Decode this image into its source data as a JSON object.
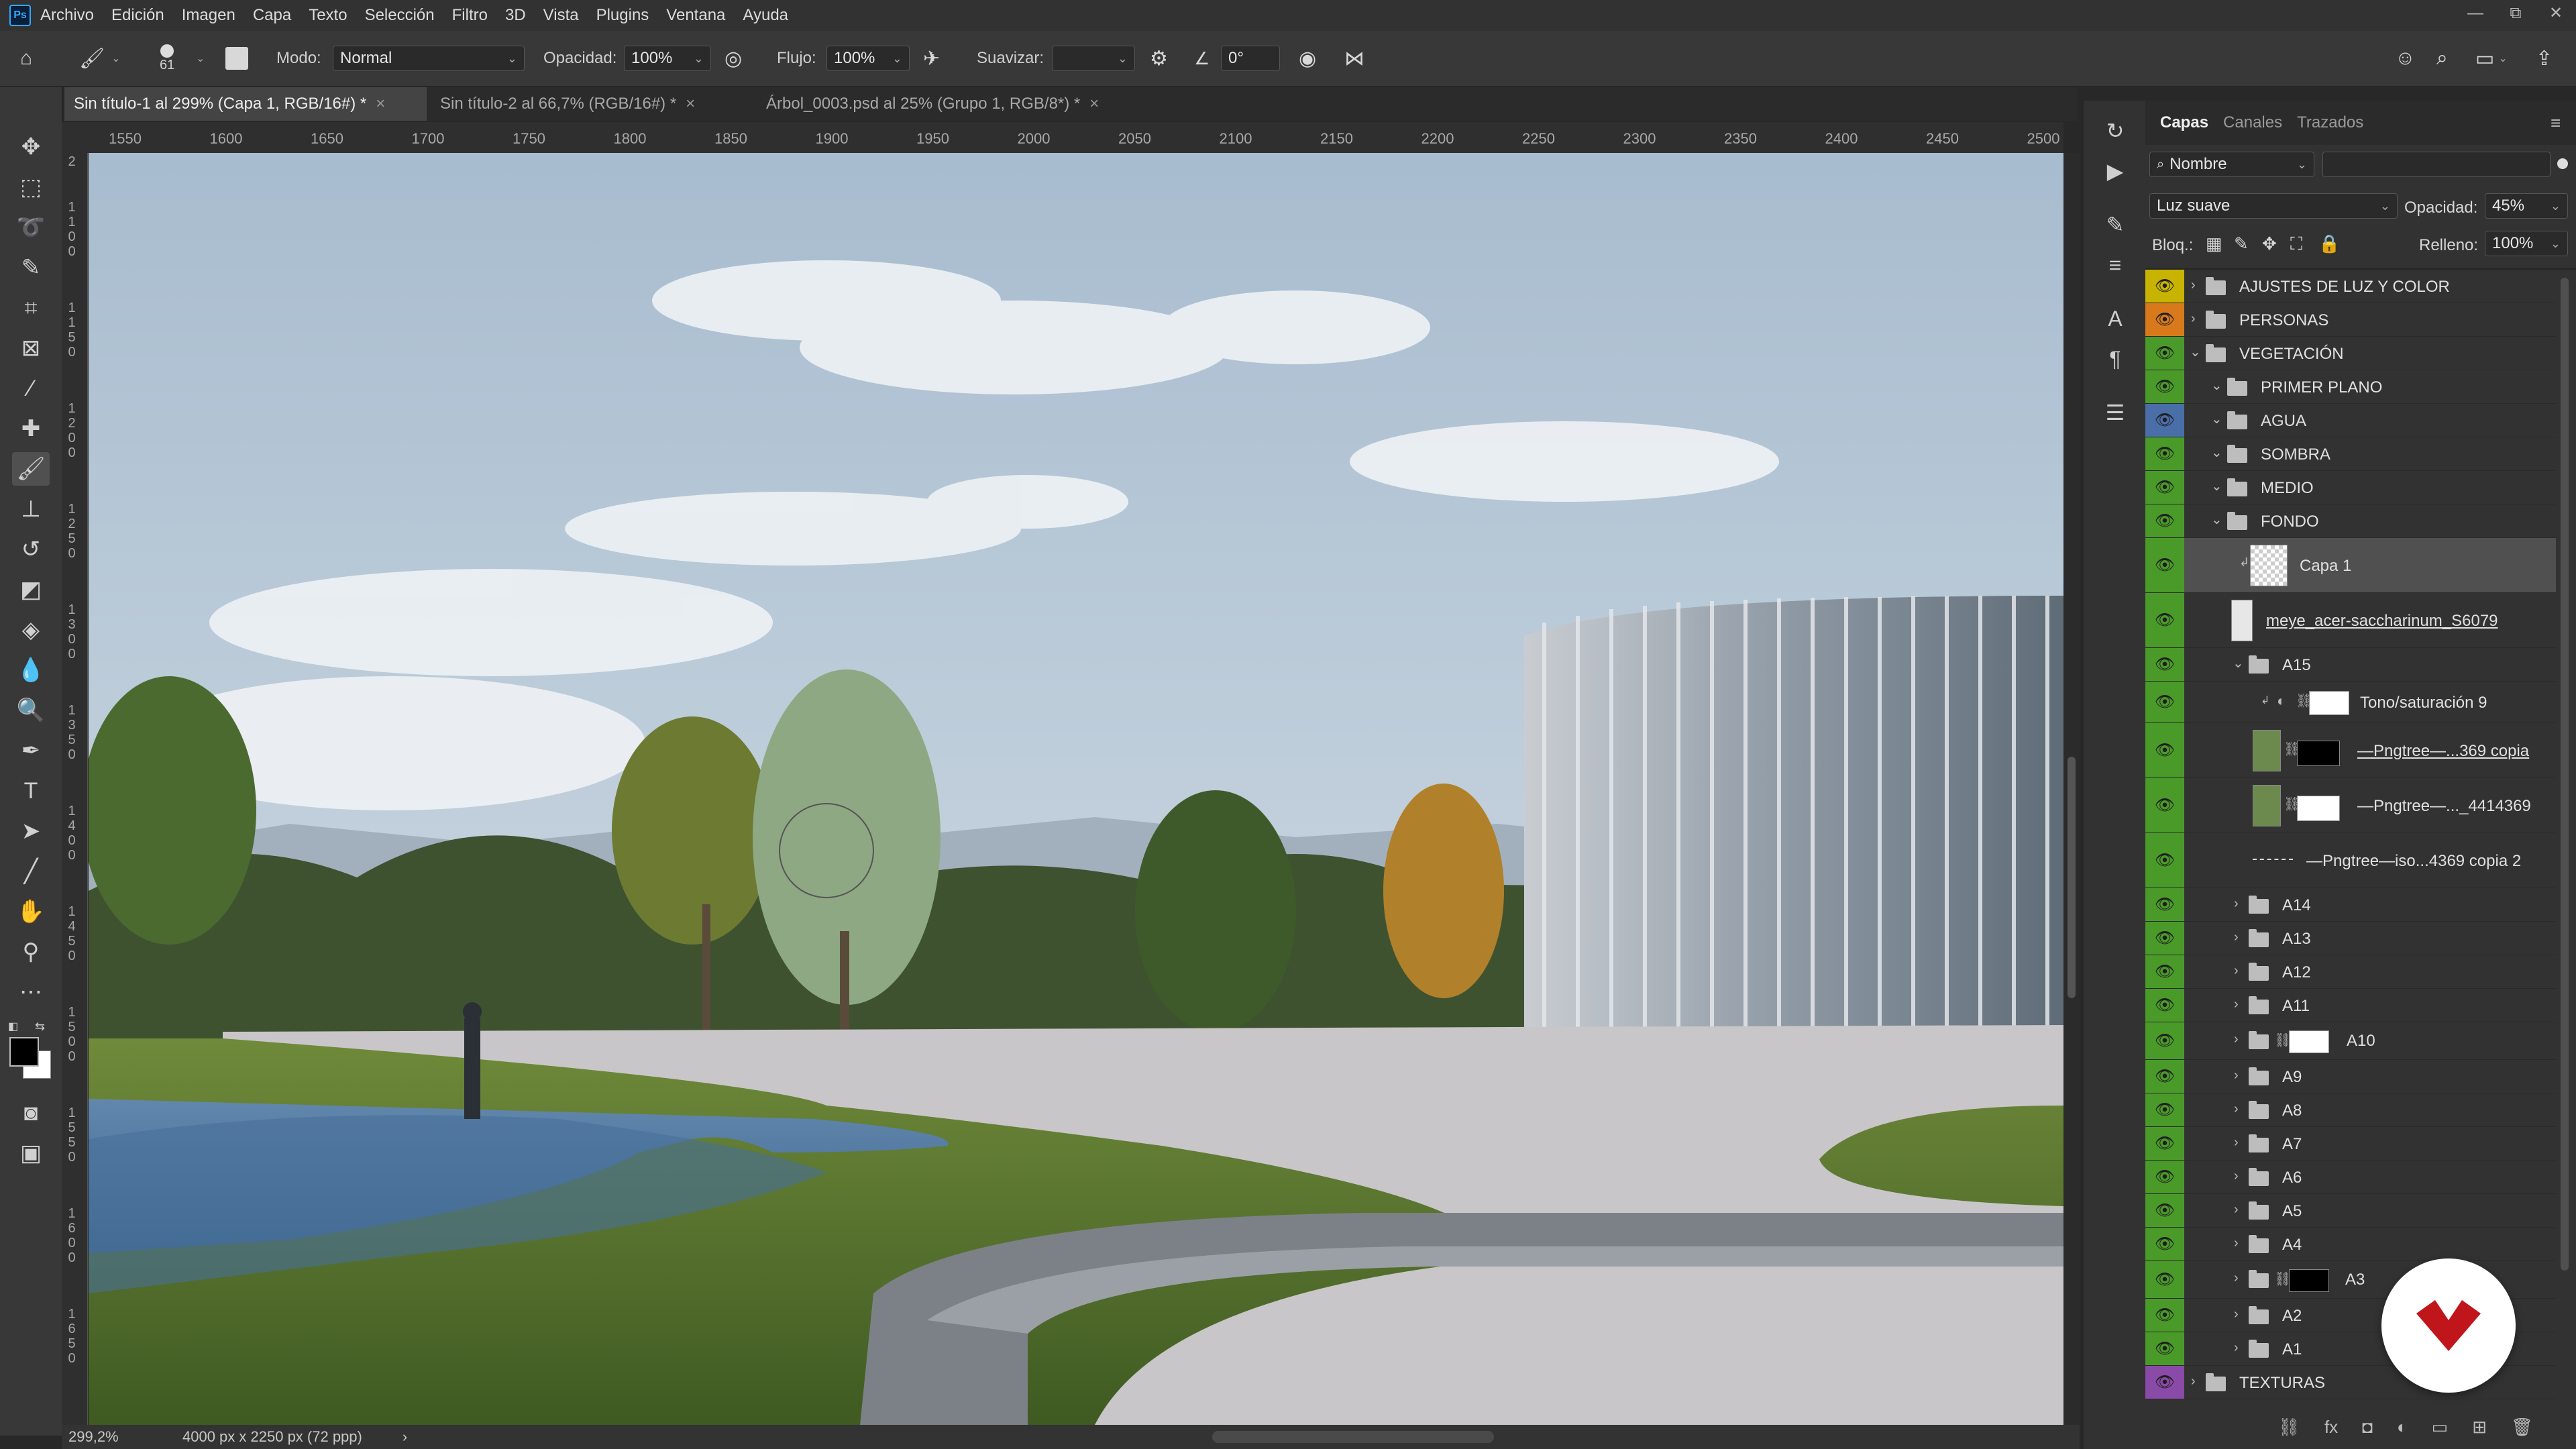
{
  "app": {
    "logo_text": "Ps"
  },
  "menu": [
    "Archivo",
    "Edición",
    "Imagen",
    "Capa",
    "Texto",
    "Selección",
    "Filtro",
    "3D",
    "Vista",
    "Plugins",
    "Ventana",
    "Ayuda"
  ],
  "window_controls": [
    "—",
    "⧉",
    "✕"
  ],
  "options": {
    "brush_size": "61",
    "mode_label": "Modo:",
    "mode_value": "Normal",
    "opacity_label": "Opacidad:",
    "opacity_value": "100%",
    "flow_label": "Flujo:",
    "flow_value": "100%",
    "smooth_label": "Suavizar:",
    "smooth_value": "",
    "angle_value": "0°"
  },
  "tabs": [
    {
      "label": "Sin título-1 al 299% (Capa 1, RGB/16#) *",
      "active": true
    },
    {
      "label": "Sin título-2 al 66,7% (RGB/16#) *",
      "active": false
    },
    {
      "label": "Árbol_0003.psd al 25% (Grupo 1, RGB/8*) *",
      "active": false
    }
  ],
  "ruler_top": [
    "1550",
    "1600",
    "1650",
    "1700",
    "1750",
    "1800",
    "1850",
    "1900",
    "1950",
    "2000",
    "2050",
    "2100",
    "2150",
    "2200",
    "2250",
    "2300",
    "2350",
    "2400",
    "2450",
    "2500"
  ],
  "ruler_left": [
    "2",
    "1 1 0 0",
    "1 1 5 0",
    "1 2 0 0",
    "1 2 5 0",
    "1 3 0 0",
    "1 3 5 0",
    "1 4 0 0",
    "1 4 5 0",
    "1 5 0 0",
    "1 5 5 0",
    "1 6 0 0",
    "1 6 5 0"
  ],
  "status": {
    "zoom": "299,2%",
    "doc_size": "4000 px x 2250 px (72 ppp)",
    "arrow": "›"
  },
  "layers_panel": {
    "tabs": [
      "Capas",
      "Canales",
      "Trazados"
    ],
    "filter_label": "Nombre",
    "blend_mode": "Luz suave",
    "opacity_label": "Opacidad:",
    "opacity_value": "45%",
    "lock_label": "Bloq.:",
    "fill_label": "Relleno:",
    "fill_value": "100%",
    "layers": [
      {
        "name": "AJUSTES DE LUZ Y COLOR",
        "eye_color": "#c8b400"
      },
      {
        "name": "PERSONAS",
        "eye_color": "#d87a1c"
      },
      {
        "name": "VEGETACIÓN",
        "eye_color": "#4a9a2a"
      },
      {
        "name": "PRIMER PLANO",
        "eye_color": "#4a9a2a"
      },
      {
        "name": "AGUA",
        "eye_color": "#4a6fa8"
      },
      {
        "name": "SOMBRA",
        "eye_color": "#4a9a2a"
      },
      {
        "name": "MEDIO",
        "eye_color": "#4a9a2a"
      },
      {
        "name": "FONDO",
        "eye_color": "#4a9a2a"
      },
      {
        "name": "Capa 1",
        "eye_color": "#4a9a2a"
      },
      {
        "name": "meye_acer-saccharinum_S6079",
        "eye_color": "#4a9a2a"
      },
      {
        "name": "A15",
        "eye_color": "#4a9a2a"
      },
      {
        "name": "Tono/saturación 9",
        "eye_color": "#4a9a2a"
      },
      {
        "name": "—Pngtree—...369 copia",
        "eye_color": "#4a9a2a"
      },
      {
        "name": "—Pngtree—..._4414369",
        "eye_color": "#4a9a2a"
      },
      {
        "name": "—Pngtree—iso...4369 copia 2",
        "eye_color": "#4a9a2a"
      },
      {
        "name": "A14",
        "eye_color": "#4a9a2a"
      },
      {
        "name": "A13",
        "eye_color": "#4a9a2a"
      },
      {
        "name": "A12",
        "eye_color": "#4a9a2a"
      },
      {
        "name": "A11",
        "eye_color": "#4a9a2a"
      },
      {
        "name": "A10",
        "eye_color": "#4a9a2a"
      },
      {
        "name": "A9",
        "eye_color": "#4a9a2a"
      },
      {
        "name": "A8",
        "eye_color": "#4a9a2a"
      },
      {
        "name": "A7",
        "eye_color": "#4a9a2a"
      },
      {
        "name": "A6",
        "eye_color": "#4a9a2a"
      },
      {
        "name": "A5",
        "eye_color": "#4a9a2a"
      },
      {
        "name": "A4",
        "eye_color": "#4a9a2a"
      },
      {
        "name": "A3",
        "eye_color": "#4a9a2a"
      },
      {
        "name": "A2",
        "eye_color": "#4a9a2a"
      },
      {
        "name": "A1",
        "eye_color": "#4a9a2a"
      },
      {
        "name": "TEXTURAS",
        "eye_color": "#8a4aa8"
      }
    ]
  },
  "colors": {
    "accent": "#31a8ff",
    "badge": "#c0151b"
  }
}
